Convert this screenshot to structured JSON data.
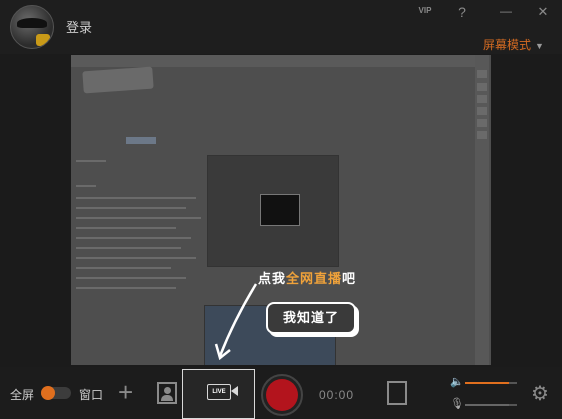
{
  "header": {
    "login_label": "登录",
    "vip_label": "VIP",
    "help_label": "?",
    "minimize_label": "—",
    "close_label": "✕",
    "mode_label": "屏幕模式",
    "mode_caret": "▼"
  },
  "overlay": {
    "tip_prefix": "点我",
    "tip_highlight": "全网直播",
    "tip_suffix": "吧",
    "got_it_label": "我知道了"
  },
  "bottom": {
    "fullscreen_label": "全屏",
    "window_label": "窗口",
    "add_label": "+",
    "live_label": "LIVE",
    "timer": "00:00",
    "mic_volume": 0.85,
    "speaker_volume": 0.85
  },
  "colors": {
    "accent": "#e06f1e",
    "record": "#b3141d",
    "background": "#1b1b1b"
  },
  "icons": [
    "avatar",
    "vip-icon",
    "help-icon",
    "minimize-icon",
    "close-icon",
    "camera-icon",
    "live-icon",
    "record-icon",
    "film-icon",
    "speaker-icon",
    "mic-icon",
    "gear-icon"
  ]
}
